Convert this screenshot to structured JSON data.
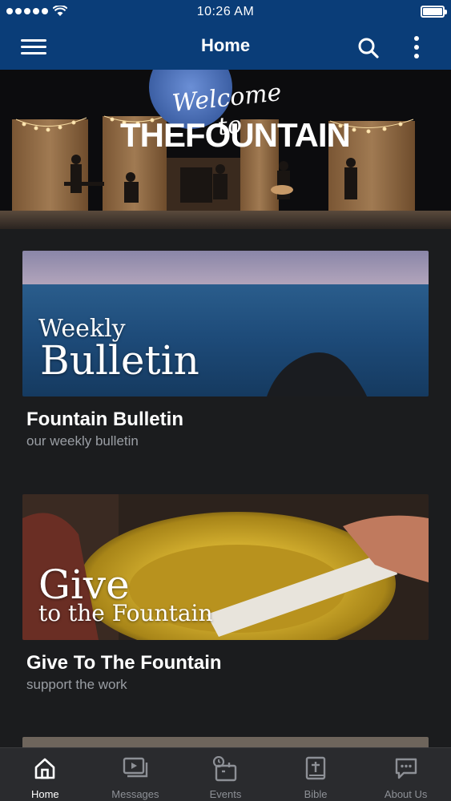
{
  "status": {
    "time": "10:26 AM"
  },
  "nav": {
    "title": "Home"
  },
  "hero": {
    "script_text": "Welcome to",
    "main_text": "THEFOUNTAIN"
  },
  "cards": [
    {
      "image_line1": "Weekly",
      "image_line2": "Bulletin",
      "title": "Fountain Bulletin",
      "subtitle": "our weekly bulletin"
    },
    {
      "image_line1": "Give",
      "image_line2": "to the Fountain",
      "title": "Give To The Fountain",
      "subtitle": "support the work"
    }
  ],
  "tabs": [
    {
      "label": "Home",
      "icon": "home-icon",
      "active": true
    },
    {
      "label": "Messages",
      "icon": "play-icon",
      "active": false
    },
    {
      "label": "Events",
      "icon": "calendar-icon",
      "active": false
    },
    {
      "label": "Bible",
      "icon": "bible-icon",
      "active": false
    },
    {
      "label": "About Us",
      "icon": "chat-icon",
      "active": false
    }
  ],
  "colors": {
    "nav_bg": "#0a3d78",
    "page_bg": "#1b1c1e",
    "tab_bg": "#2a2b2e",
    "subtitle": "#9a9ea4"
  }
}
